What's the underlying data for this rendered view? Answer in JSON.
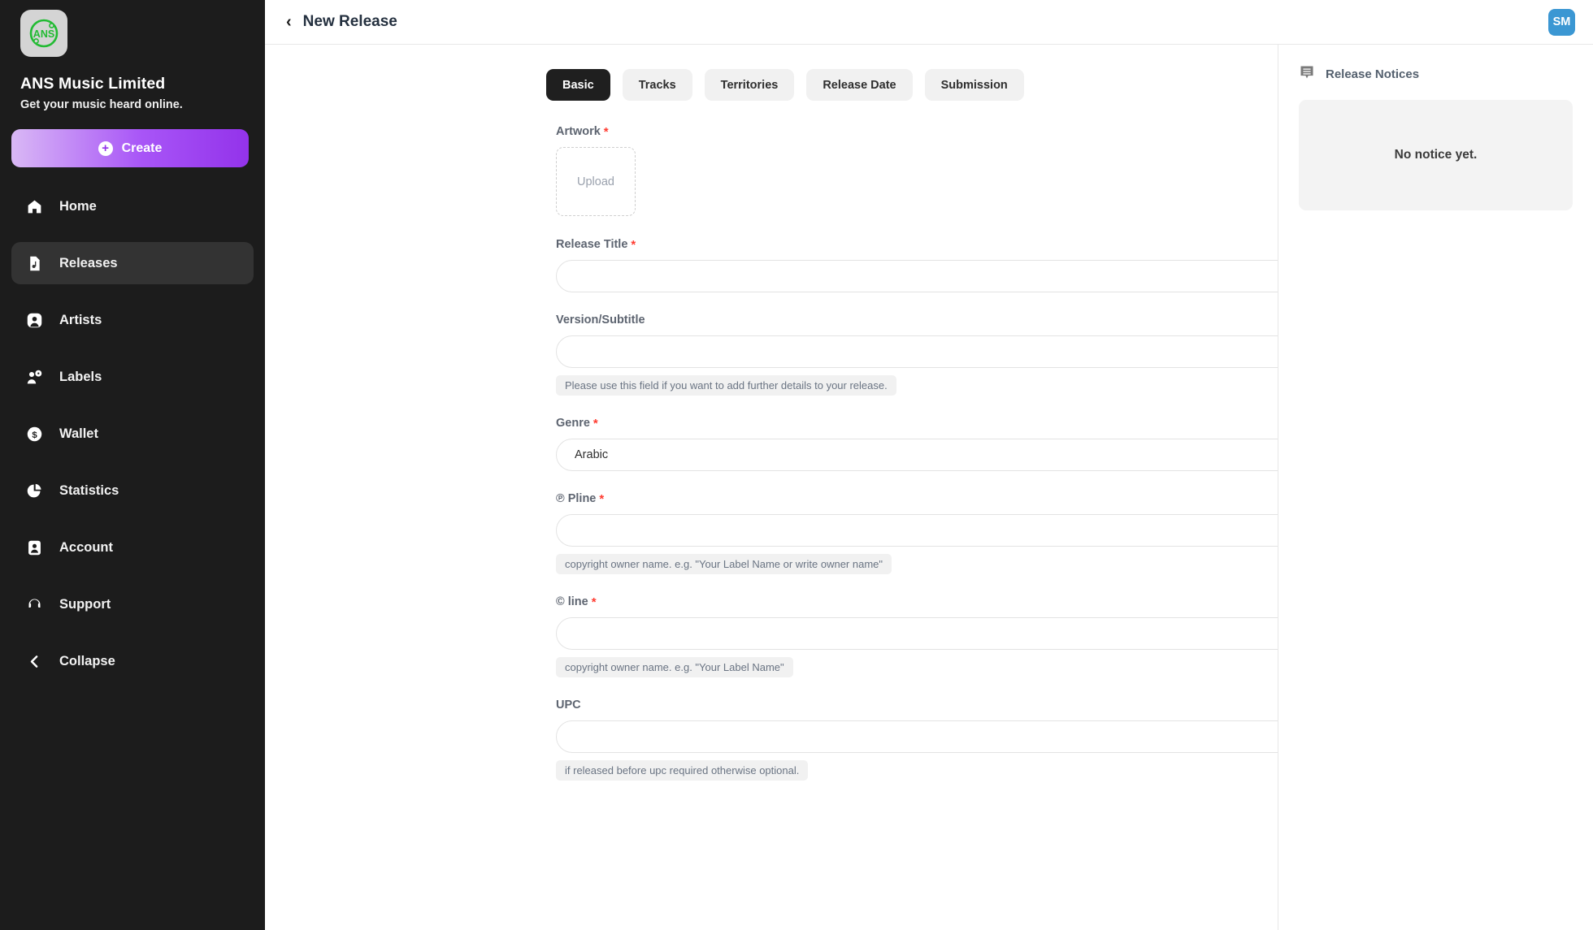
{
  "sidebar": {
    "logo_text": "ANS",
    "brand_name": "ANS Music Limited",
    "brand_tagline": "Get your music heard online.",
    "create_label": "Create",
    "items": [
      {
        "label": "Home",
        "icon": "home-icon",
        "active": false
      },
      {
        "label": "Releases",
        "icon": "file-music-icon",
        "active": true
      },
      {
        "label": "Artists",
        "icon": "artist-icon",
        "active": false
      },
      {
        "label": "Labels",
        "icon": "labels-icon",
        "active": false
      },
      {
        "label": "Wallet",
        "icon": "dollar-coin-icon",
        "active": false
      },
      {
        "label": "Statistics",
        "icon": "pie-chart-icon",
        "active": false
      },
      {
        "label": "Account",
        "icon": "person-card-icon",
        "active": false
      },
      {
        "label": "Support",
        "icon": "headset-icon",
        "active": false
      },
      {
        "label": "Collapse",
        "icon": "chevron-left-icon",
        "active": false
      }
    ]
  },
  "topbar": {
    "back_icon": "chevron-left-icon",
    "title": "New Release",
    "avatar_initials": "SM",
    "avatar_color": "#3b97d3"
  },
  "tabs": [
    {
      "label": "Basic",
      "active": true
    },
    {
      "label": "Tracks",
      "active": false
    },
    {
      "label": "Territories",
      "active": false
    },
    {
      "label": "Release Date",
      "active": false
    },
    {
      "label": "Submission",
      "active": false
    }
  ],
  "form": {
    "artwork": {
      "label": "Artwork",
      "required": true,
      "upload_text": "Upload"
    },
    "release_title": {
      "label": "Release Title",
      "required": true,
      "value": "",
      "placeholder": ""
    },
    "version_subtitle": {
      "label": "Version/Subtitle",
      "required": false,
      "value": "",
      "placeholder": "",
      "hint": "Please use this field if you want to add further details to your release."
    },
    "genre": {
      "label": "Genre",
      "required": true,
      "value": "Arabic"
    },
    "pline": {
      "label": "℗ Pline",
      "required": true,
      "value": "",
      "placeholder": "",
      "hint": "copyright owner name. e.g. \"Your Label Name or write owner name\""
    },
    "cline": {
      "label": "© line",
      "required": true,
      "value": "",
      "placeholder": "",
      "hint": "copyright owner name. e.g. \"Your Label Name\""
    },
    "upc": {
      "label": "UPC",
      "required": false,
      "value": "",
      "placeholder": "",
      "hint": "if released before upc required otherwise optional."
    }
  },
  "right_panel": {
    "icon": "notice-bubble-icon",
    "title": "Release Notices",
    "empty_text": "No notice yet."
  },
  "colors": {
    "sidebar_bg": "#1c1c1c",
    "sidebar_active": "#333333",
    "accent_purple": "#9333ea",
    "required_red": "#ff3b30",
    "tab_active_bg": "#1f1f1f",
    "hint_bg": "#f1f1f1"
  }
}
